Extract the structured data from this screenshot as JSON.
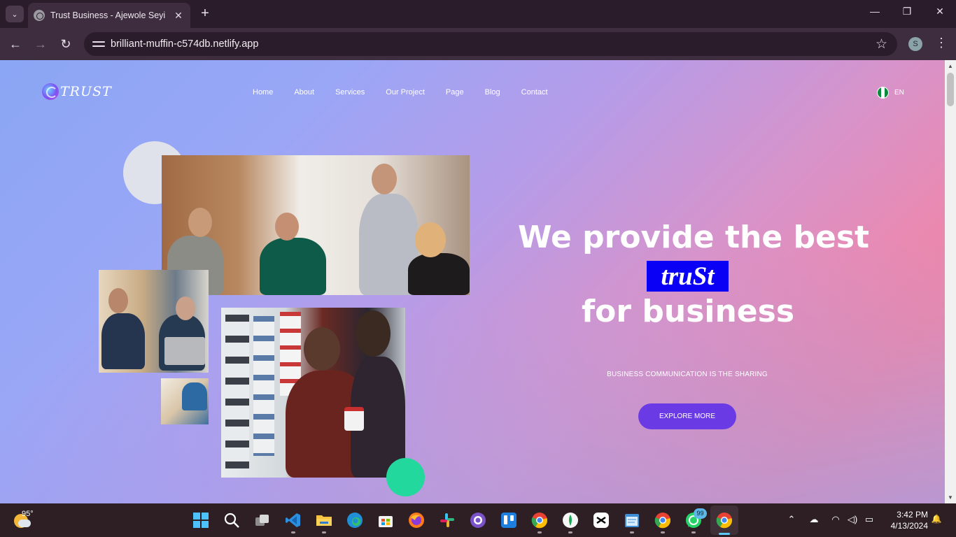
{
  "browser": {
    "tab_title": "Trust Business - Ajewole Seyi",
    "url": "brilliant-muffin-c574db.netlify.app",
    "profile_initial": "S",
    "icons": {
      "tab_list": "chevron-down-icon",
      "favicon": "globe-icon",
      "close": "close-icon",
      "new_tab": "plus-icon",
      "back": "back-arrow-icon",
      "forward": "forward-arrow-icon",
      "reload": "reload-icon",
      "site_info": "tune-icon",
      "bookmark": "star-icon",
      "menu": "kebab-icon"
    },
    "glyphs": {
      "tab_list": "⌄",
      "close": "✕",
      "new_tab": "+",
      "minimize": "—",
      "maximize": "❐",
      "window_close": "✕",
      "back": "←",
      "forward": "→",
      "reload": "↻",
      "star": "☆",
      "kebab": "⋮"
    }
  },
  "site": {
    "logo_text": "TRUST",
    "nav": [
      "Home",
      "About",
      "Services",
      "Our Project",
      "Page",
      "Blog",
      "Contact"
    ],
    "language": "EN",
    "hero": {
      "line1": "We provide the best",
      "brand": "truSt",
      "line3": "for business",
      "subtitle": "BUSINESS COMMUNICATION IS THE SHARING",
      "cta": "EXPLORE MORE"
    },
    "colors": {
      "cta": "#6a3be4",
      "brand_box": "#0a00f5",
      "accent_green": "#23d89d",
      "gradient_start": "#8aa6f4",
      "gradient_end": "#f384a4"
    }
  },
  "taskbar": {
    "weather_temp": "95°",
    "whatsapp_badge": "99",
    "chrome_profile_initial": "S",
    "time": "3:42 PM",
    "date": "4/13/2024",
    "apps": [
      "start-icon",
      "search-icon",
      "task-view-icon",
      "vscode-icon",
      "file-explorer-icon",
      "edge-icon",
      "store-icon",
      "firefox-icon",
      "slack-icon",
      "github-desktop-icon",
      "trello-icon",
      "chrome-icon",
      "mongodb-compass-icon",
      "capcut-icon",
      "notepad-icon",
      "chrome-icon",
      "whatsapp-icon",
      "chrome-icon"
    ],
    "tray_glyphs": {
      "overflow": "⌃",
      "cloud": "☁",
      "wifi": "◠",
      "volume": "◁)",
      "battery": "▭",
      "bell": "🔔"
    }
  }
}
